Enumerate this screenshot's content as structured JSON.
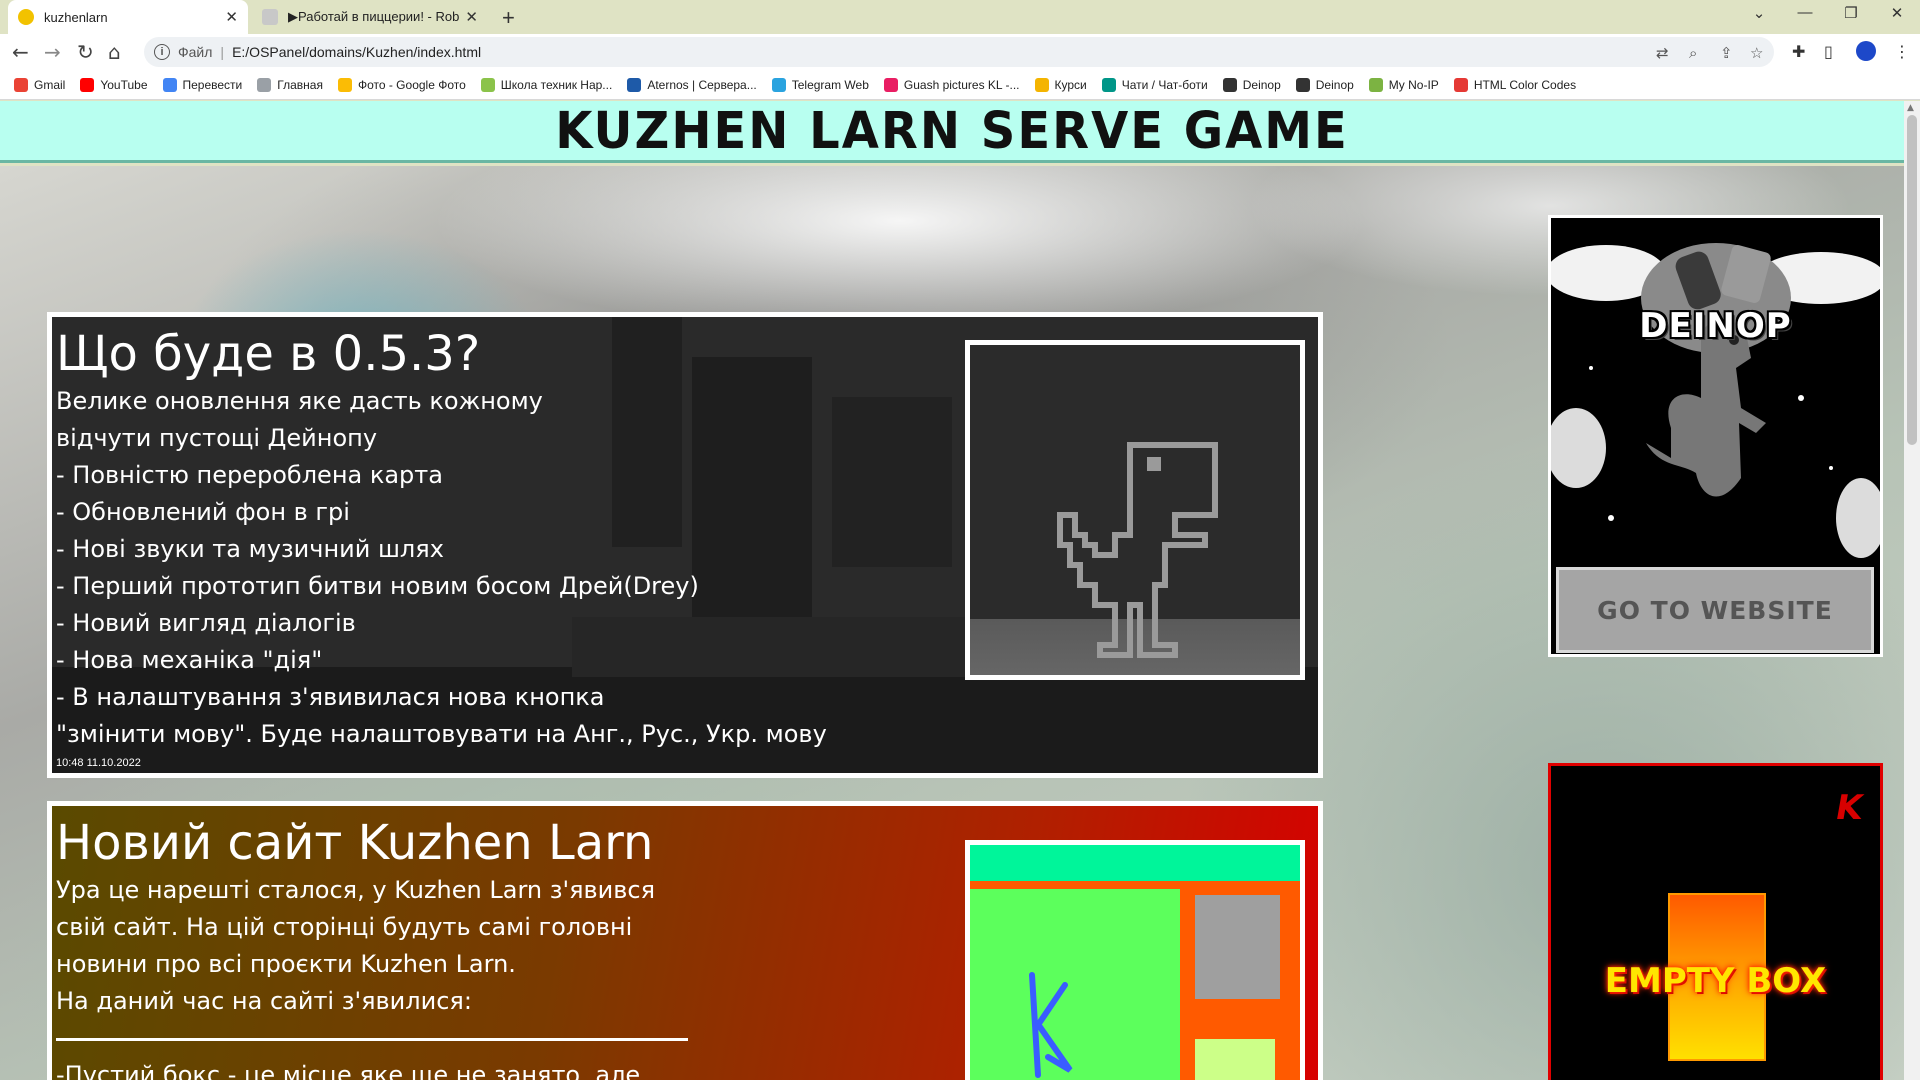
{
  "browser": {
    "tabs": [
      {
        "title": "kuzhenlarn",
        "close": "✕"
      },
      {
        "title": "▶Работай в пиццерии! - Roblo",
        "close": "✕"
      }
    ],
    "new_tab": "+",
    "window_controls": {
      "minimize": "⌄",
      "restore": "—",
      "maximize": "❐",
      "close": "✕"
    },
    "nav": {
      "back": "←",
      "forward": "→",
      "reload": "↻",
      "home": "⌂"
    },
    "address": {
      "info": "i",
      "scheme": "Файл",
      "separator": "|",
      "url": "E:/OSPanel/domains/Kuzhen/index.html"
    },
    "bookmarks": [
      {
        "label": "Gmail",
        "color": "#ea4335"
      },
      {
        "label": "YouTube",
        "color": "#ff0000"
      },
      {
        "label": "Перевести",
        "color": "#4285f4"
      },
      {
        "label": "Главная",
        "color": "#9aa0a6"
      },
      {
        "label": "Фото - Google Фото",
        "color": "#fbbc05"
      },
      {
        "label": "Школа техник Нар...",
        "color": "#8bc34a"
      },
      {
        "label": "Aternos | Сервера...",
        "color": "#1e5aa8"
      },
      {
        "label": "Telegram Web",
        "color": "#2aa3df"
      },
      {
        "label": "Guash pictures KL -...",
        "color": "#e91e63"
      },
      {
        "label": "Курси",
        "color": "#f4b400"
      },
      {
        "label": "Чати / Чат-боти",
        "color": "#009688"
      },
      {
        "label": "Deinop",
        "color": "#333333"
      },
      {
        "label": "Deinop",
        "color": "#333333"
      },
      {
        "label": "My No-IP",
        "color": "#7cb342"
      },
      {
        "label": "HTML Color Codes",
        "color": "#e53935"
      }
    ]
  },
  "site": {
    "title": "KUZHEN LARN SERVE GAME"
  },
  "news": [
    {
      "title": "Що буде в 0.5.3?",
      "lines": [
        "Велике оновлення яке дасть кожному",
        "відчути пустощі Дейнопу",
        "- Повністю перероблена карта",
        "- Обновлений фон в грі",
        "- Нові звуки та музичний шлях",
        "- Перший прототип битви новим босом Дрей(Drey)",
        "- Новий вигляд діалогів",
        "- Нова механіка \"дія\"",
        "- В налаштування з'явивилася нова кнопка",
        "\"змінити мову\". Буде налаштовувати на Анг., Рус., Укр. мову"
      ],
      "date": "10:48 11.10.2022"
    },
    {
      "title": "Новий сайт Kuzhen Larn",
      "lines": [
        "Ура це нарешті сталося, у Kuzhen Larn з'явився",
        "свій сайт. На цій сторінці будуть самі головні",
        "новини про всі проєкти Kuzhen Larn.",
        "На даний час на сайті з'явилися:"
      ],
      "after_divider": "-Пустий бокс - це місце яке ще не занято, але"
    }
  ],
  "ads": {
    "deinop": {
      "logo": "DEINOP",
      "button": "GO TO WEBSITE"
    },
    "empty_box": {
      "title": "EMPTY BOX",
      "corner_mark": "K"
    }
  },
  "colors": {
    "header_bg": "#b8fff0",
    "ad_empty_border": "#e00000"
  }
}
